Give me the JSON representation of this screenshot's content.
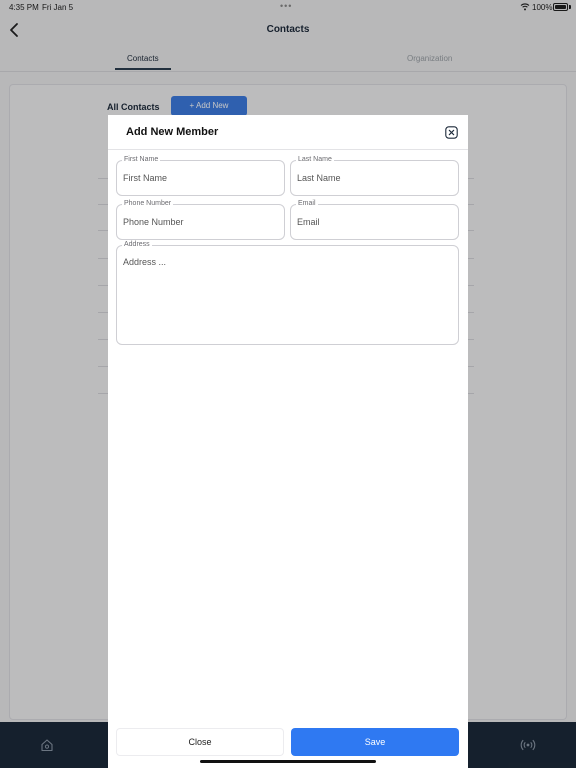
{
  "status_bar": {
    "time": "4:35 PM",
    "date": "Fri Jan 5",
    "multitask_dots": "•••",
    "battery_percent": "100%",
    "icons": [
      "wifi-icon",
      "battery-icon"
    ]
  },
  "nav": {
    "title": "Contacts",
    "back_icon": "chevron-left-icon"
  },
  "tabs": [
    {
      "label": "Contacts",
      "active": true
    },
    {
      "label": "Organization",
      "active": false
    }
  ],
  "contacts_page": {
    "section_title": "All Contacts",
    "add_button_label": "+ Add New"
  },
  "bottom_bar": {
    "icons": [
      "home-icon",
      "broadcast-icon"
    ]
  },
  "modal": {
    "title": "Add New Member",
    "close_icon": "close-icon",
    "fields": {
      "first_name": {
        "label": "First Name",
        "placeholder": "First Name",
        "value": ""
      },
      "last_name": {
        "label": "Last Name",
        "placeholder": "Last Name",
        "value": ""
      },
      "phone": {
        "label": "Phone Number",
        "placeholder": "Phone Number",
        "value": ""
      },
      "email": {
        "label": "Email",
        "placeholder": "Email",
        "value": ""
      },
      "address": {
        "label": "Address",
        "placeholder": "Address ...",
        "value": ""
      }
    },
    "buttons": {
      "close_label": "Close",
      "save_label": "Save"
    }
  },
  "colors": {
    "accent": "#2f79f2",
    "nav_dark": "#1c2a3a",
    "overlay": "rgba(0,0,0,0.22)"
  }
}
